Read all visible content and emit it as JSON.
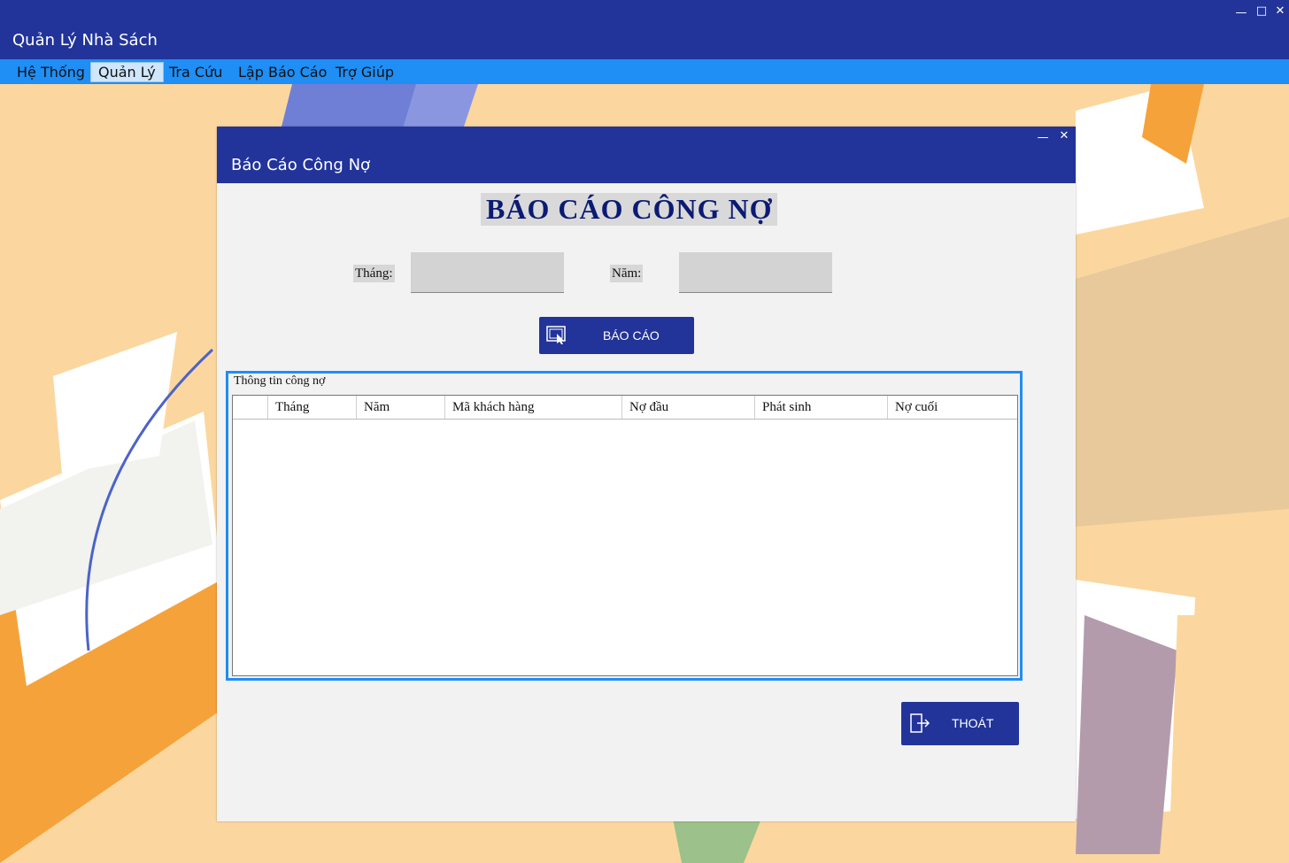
{
  "app": {
    "title": "Quản Lý Nhà Sách",
    "minimize_glyph": "—",
    "maximize_glyph": "□",
    "close_glyph": "✕"
  },
  "menu": {
    "items": [
      {
        "label": "Hệ Thống",
        "active": false
      },
      {
        "label": "Quản Lý",
        "active": true
      },
      {
        "label": "Tra Cứu",
        "active": false
      },
      {
        "label": "Lập Báo Cáo",
        "active": false
      },
      {
        "label": "Trợ Giúp",
        "active": false
      }
    ]
  },
  "report_window": {
    "title": "Báo Cáo Công Nợ",
    "minimize_glyph": "—",
    "close_glyph": "✕",
    "heading": "BÁO CÁO CÔNG NỢ",
    "month_label": "Tháng:",
    "month_value": "",
    "year_label": "Năm:",
    "year_value": "",
    "report_button": "BÁO CÁO",
    "group_title": "Thông tin công nợ",
    "columns": [
      "Tháng",
      "Năm",
      "Mã khách hàng",
      "Nợ đầu",
      "Phát sinh",
      "Nợ cuối"
    ],
    "exit_button": "THOÁT"
  },
  "colors": {
    "titlebar": "#22349a",
    "menubar": "#1f8ef5",
    "desktop": "#fbd79f",
    "accent_button": "#22349a"
  },
  "icons": {
    "report_button_icon": "report-icon",
    "exit_button_icon": "exit-icon"
  }
}
